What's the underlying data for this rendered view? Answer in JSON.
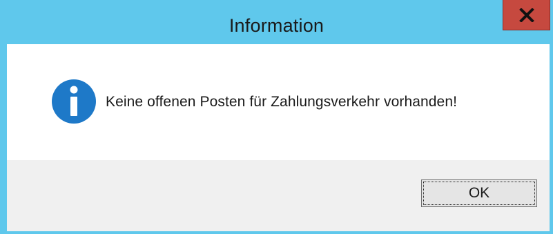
{
  "window": {
    "title": "Information",
    "close_glyph": "x"
  },
  "message": {
    "icon": "info-icon",
    "text": "Keine offenen Posten für Zahlungsverkehr vorhanden!"
  },
  "buttons": {
    "ok_label": "OK"
  },
  "colors": {
    "frame": "#5fc8ec",
    "close_button": "#c6493f",
    "info_icon": "#1e79c8",
    "button_panel": "#f0f0f0",
    "message_panel": "#ffffff"
  }
}
